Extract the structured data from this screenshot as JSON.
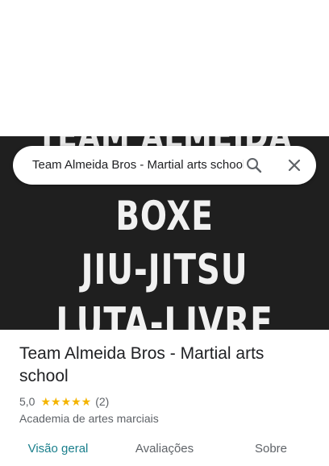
{
  "hero": {
    "lines": [
      "TEAM ALMEIDA",
      "BOXE",
      "JIU-JITSU",
      "LUTA-LIVRE"
    ]
  },
  "search": {
    "query": "Team Almeida Bros - Martial arts school"
  },
  "icons": {
    "search": "search-icon",
    "close": "close-icon",
    "star": "star-icon"
  },
  "place": {
    "title": "Team Almeida Bros - Martial arts school",
    "rating": "5,0",
    "stars": "★★★★★",
    "review_count": "(2)",
    "category": "Academia de artes marciais"
  },
  "tabs": [
    {
      "label": "Visão geral",
      "active": true
    },
    {
      "label": "Avaliações",
      "active": false
    },
    {
      "label": "Sobre",
      "active": false
    }
  ],
  "colors": {
    "accent": "#1a7f8c",
    "star": "#f4b400",
    "hero_bg": "#1f1f1f"
  }
}
